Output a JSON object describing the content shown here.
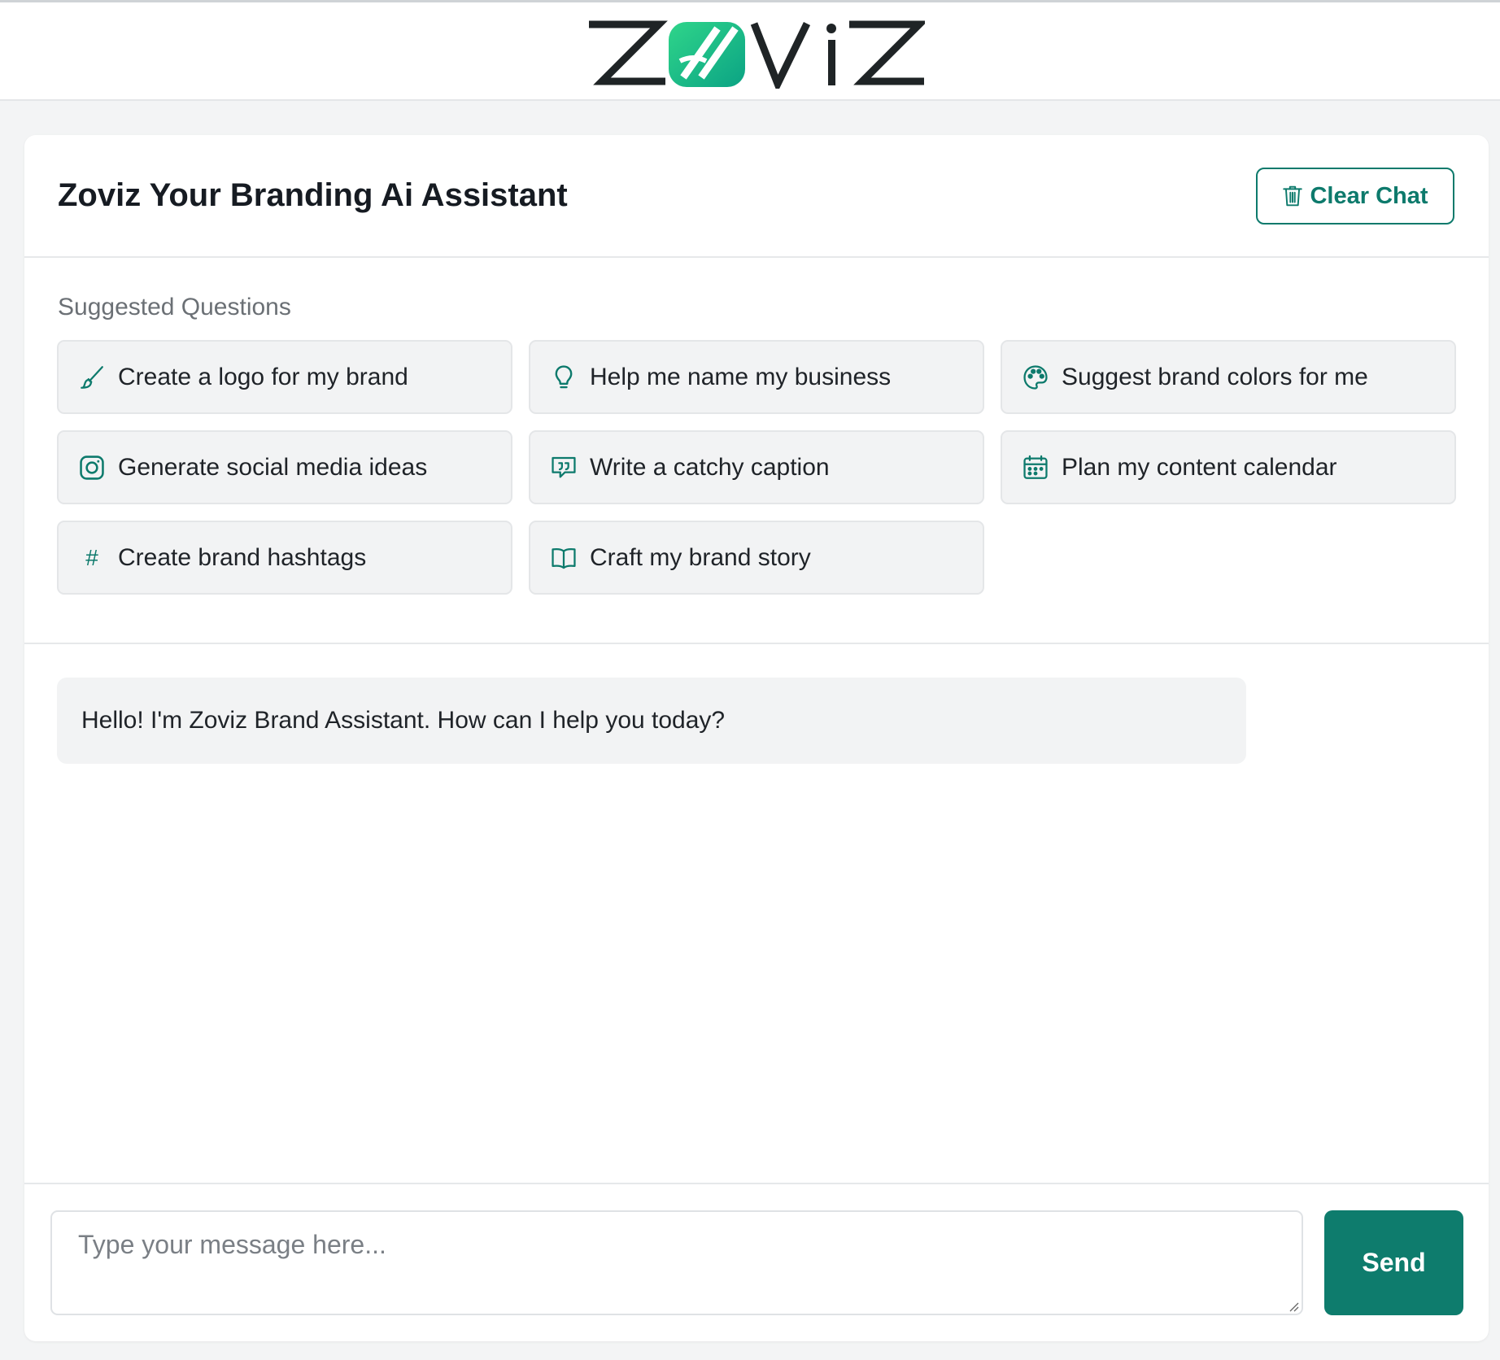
{
  "header": {
    "logo_text": "ZOVIZ",
    "logo_icon": "zoviz-logo-icon"
  },
  "colors": {
    "accent": "#0E7C6D",
    "logo_gradient_start": "#2FD58A",
    "logo_gradient_end": "#0BA384",
    "logo_dark": "#1F2426"
  },
  "card": {
    "title": "Zoviz Your Branding Ai Assistant",
    "clear_label": "Clear Chat",
    "clear_icon": "trash-icon"
  },
  "suggestions": {
    "label": "Suggested Questions",
    "items": [
      {
        "label": "Create a logo for my brand",
        "icon": "brush-icon"
      },
      {
        "label": "Help me name my business",
        "icon": "lightbulb-icon"
      },
      {
        "label": "Suggest brand colors for me",
        "icon": "palette-icon"
      },
      {
        "label": "Generate social media ideas",
        "icon": "instagram-icon"
      },
      {
        "label": "Write a catchy caption",
        "icon": "quote-icon"
      },
      {
        "label": "Plan my content calendar",
        "icon": "calendar-icon"
      },
      {
        "label": "Create brand hashtags",
        "icon": "hashtag-icon",
        "glyph": "#"
      },
      {
        "label": "Craft my brand story",
        "icon": "book-icon"
      }
    ]
  },
  "chat": {
    "messages": [
      {
        "role": "assistant",
        "text": "Hello! I'm Zoviz Brand Assistant. How can I help you today?"
      }
    ]
  },
  "composer": {
    "placeholder": "Type your message here...",
    "send_label": "Send"
  }
}
